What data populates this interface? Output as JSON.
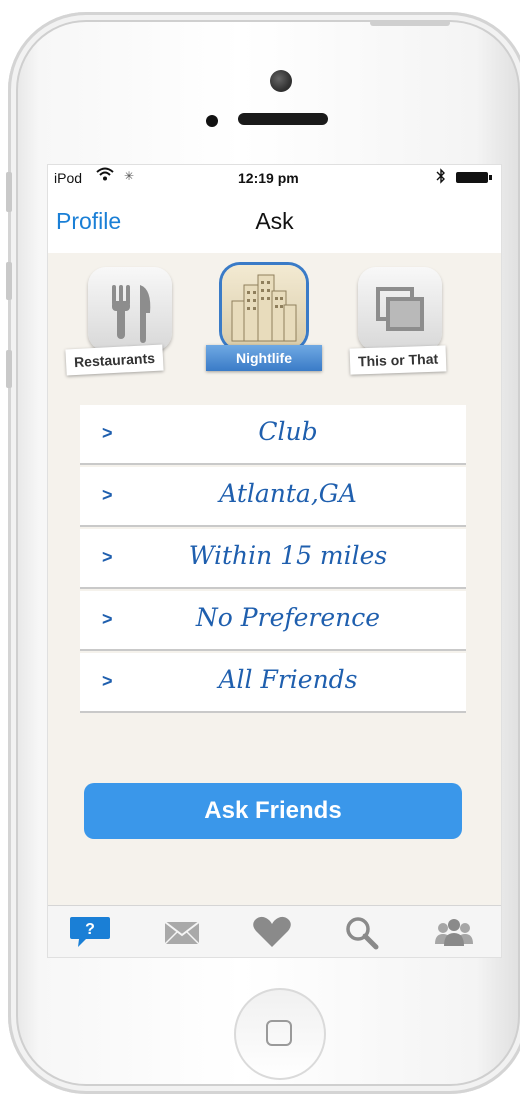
{
  "status_bar": {
    "carrier": "iPod",
    "wifi_icon": "wifi-icon",
    "activity_icon": "activity-spinner-icon",
    "time": "12:19 pm",
    "bluetooth_icon": "bluetooth-icon",
    "battery_icon": "battery-icon"
  },
  "nav": {
    "back_label": "Profile",
    "title": "Ask"
  },
  "categories": [
    {
      "label": "Restaurants",
      "icon": "fork-knife-icon",
      "selected": false
    },
    {
      "label": "Nightlife",
      "icon": "city-buildings-icon",
      "selected": true
    },
    {
      "label": "This or That",
      "icon": "photos-stack-icon",
      "selected": false
    }
  ],
  "options": [
    {
      "chevron": ">",
      "text": "Club"
    },
    {
      "chevron": ">",
      "text": "Atlanta,GA"
    },
    {
      "chevron": ">",
      "text": "Within 15 miles"
    },
    {
      "chevron": ">",
      "text": "No Preference"
    },
    {
      "chevron": ">",
      "text": "All Friends"
    }
  ],
  "ask_button": {
    "label": "Ask Friends"
  },
  "tab_bar": {
    "tabs": [
      {
        "icon": "question-bubble-icon",
        "active": true
      },
      {
        "icon": "envelope-icon",
        "active": false
      },
      {
        "icon": "heart-icon",
        "active": false
      },
      {
        "icon": "search-icon",
        "active": false
      },
      {
        "icon": "friends-group-icon",
        "active": false
      }
    ],
    "question_mark": "?"
  },
  "colors": {
    "accent": "#1a7fd6",
    "button": "#3a97ea",
    "option_text": "#1f5fae",
    "background": "#f5f2ec"
  }
}
